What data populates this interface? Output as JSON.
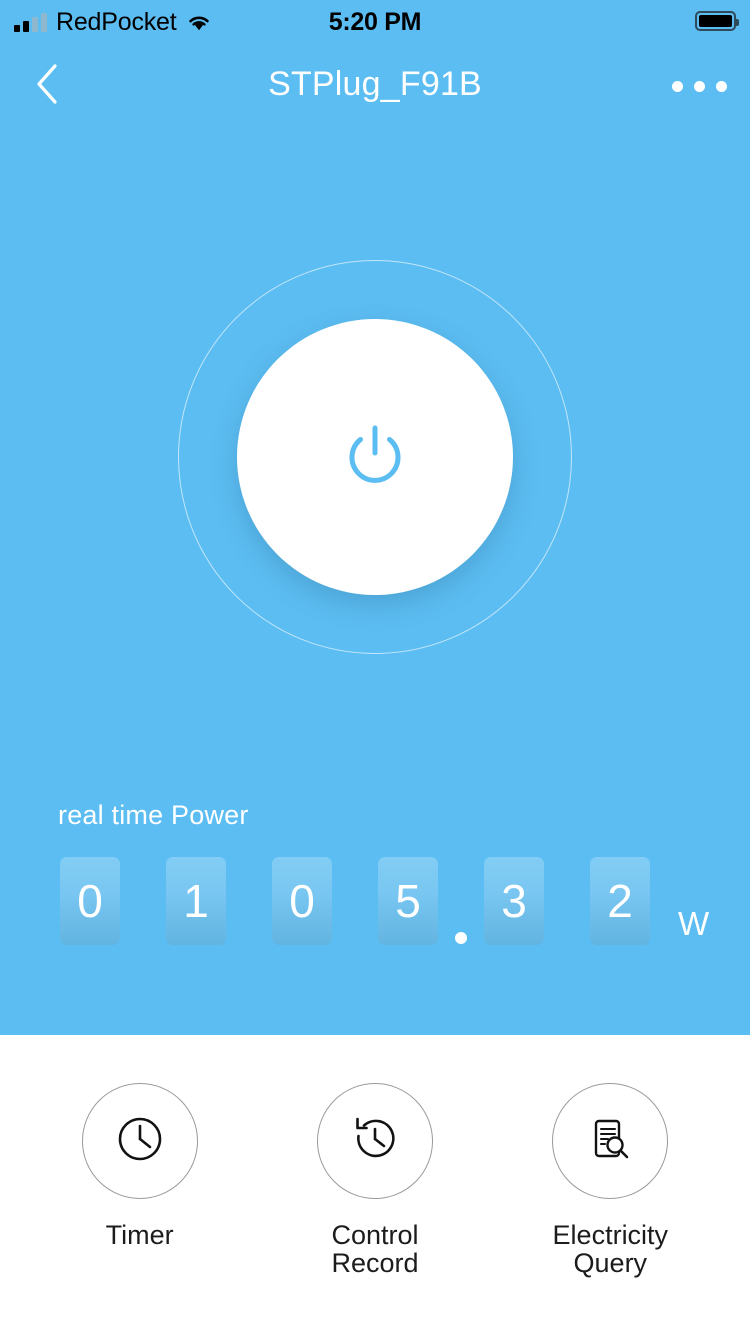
{
  "theme": {
    "accent": "#5cbdf2",
    "hero_bg": "#5cbdf2",
    "footer_bg": "#ffffff",
    "button_face": "#ffffff",
    "label_text": "#1c1c1c"
  },
  "status_bar": {
    "carrier": "RedPocket",
    "time": "5:20 PM",
    "signal_icon": "cellular-signal-icon",
    "signal_bars_filled": 2,
    "signal_bars_total": 4,
    "wifi_icon": "wifi-icon",
    "battery_icon": "battery-full-icon"
  },
  "navbar": {
    "title": "STPlug_F91B",
    "back_icon": "chevron-left-icon",
    "more_icon": "more-horizontal-icon"
  },
  "power": {
    "state_icon": "power-icon",
    "ring_icon": "outer-ring"
  },
  "realtime": {
    "label": "real time Power",
    "digits": [
      "0",
      "1",
      "0",
      "5",
      "3",
      "2"
    ],
    "decimal_separator": ".",
    "decimal_after_index": 3,
    "value": "0105.32",
    "unit": "W"
  },
  "footer": {
    "actions": [
      {
        "label": "Timer",
        "icon": "clock-icon"
      },
      {
        "label": "Control\nRecord",
        "icon": "history-icon"
      },
      {
        "label": "Electricity\nQuery",
        "icon": "document-search-icon"
      }
    ]
  }
}
